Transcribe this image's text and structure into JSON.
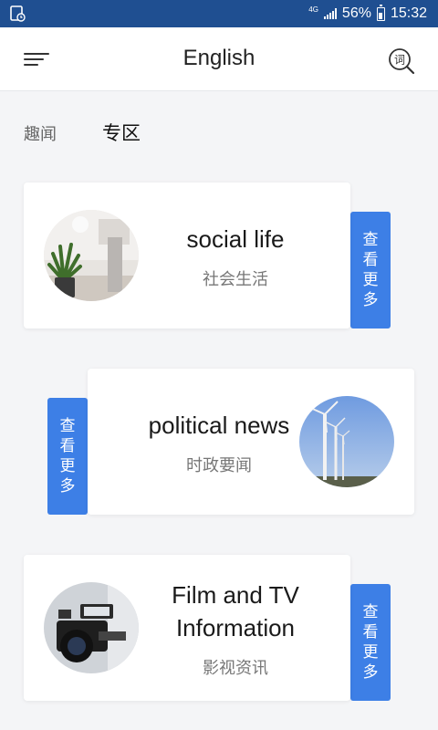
{
  "status_bar": {
    "network": "4G",
    "battery": "56%",
    "time": "15:32"
  },
  "header": {
    "title": "English",
    "dict_icon": "词"
  },
  "tabs": [
    {
      "label": "趣闻",
      "active": false
    },
    {
      "label": "专区",
      "active": true
    }
  ],
  "accent_color": "#3d7fe6",
  "cards": [
    {
      "title": "social life",
      "subtitle": "社会生活",
      "more": "查看更多",
      "image": "plant-on-desk-image"
    },
    {
      "title": "political news",
      "subtitle": "时政要闻",
      "more": "查看更多",
      "image": "wind-turbines-image"
    },
    {
      "title_line1": "Film and TV",
      "title_line2": "Information",
      "subtitle": "影视资讯",
      "more": "查看更多",
      "image": "video-camera-image"
    }
  ]
}
